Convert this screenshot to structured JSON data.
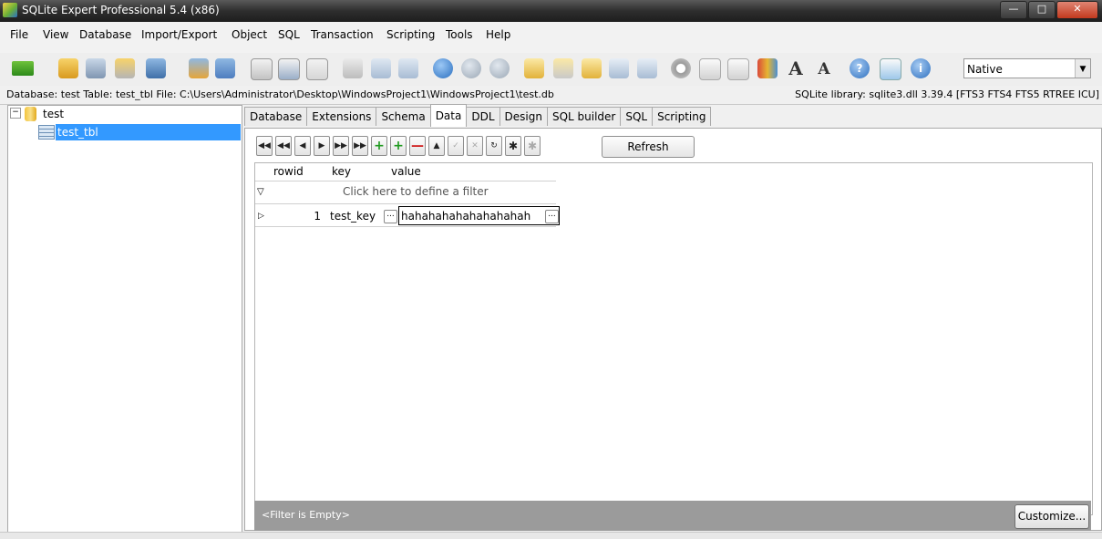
{
  "window": {
    "title": "SQLite Expert Professional 5.4 (x86)"
  },
  "menu": [
    "File",
    "View",
    "Database",
    "Import/Export",
    "Object",
    "SQL",
    "Transaction",
    "Scripting",
    "Tools",
    "Help"
  ],
  "toolbar": {
    "encoding": "Native"
  },
  "info": {
    "left": "Database: test   Table: test_tbl   File: C:\\Users\\Administrator\\Desktop\\WindowsProject1\\WindowsProject1\\test.db",
    "right": "SQLite library: sqlite3.dll 3.39.4 [FTS3 FTS4 FTS5 RTREE ICU]"
  },
  "tree": {
    "database": "test",
    "table": "test_tbl"
  },
  "tabs": [
    "Database",
    "Extensions",
    "Schema",
    "Data",
    "DDL",
    "Design",
    "SQL builder",
    "SQL",
    "Scripting"
  ],
  "data_tab": {
    "refresh_label": "Refresh",
    "columns": [
      "rowid",
      "key",
      "value"
    ],
    "filter_hint": "Click here to define a filter",
    "rows": [
      {
        "rowid": "1",
        "key": "test_key",
        "value": "hahahahahahahahahah"
      }
    ],
    "filter_status": "<Filter is Empty>",
    "customize_label": "Customize..."
  }
}
